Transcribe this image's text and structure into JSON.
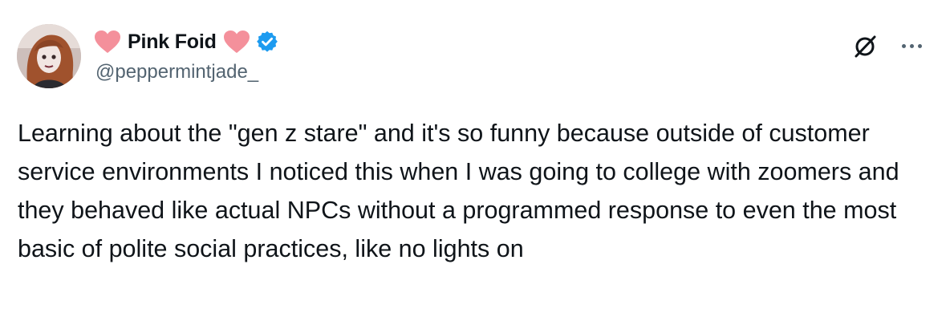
{
  "author": {
    "display_name": "Pink Foid",
    "handle": "@peppermintjade_",
    "verified": true,
    "name_emoji": "heart-icon"
  },
  "tweet": {
    "text": "Learning about the \"gen z stare\" and it's so funny because outside of customer service environments I noticed this when I was going to college with zoomers and they behaved like actual NPCs without a programmed response to even the most basic of polite social practices, like no lights on"
  },
  "colors": {
    "heart": "#f4909b",
    "verified": "#1d9bf0",
    "handle": "#536471",
    "text": "#0f1419"
  },
  "icons": {
    "grok": "grok-icon",
    "more": "more-options-icon"
  }
}
